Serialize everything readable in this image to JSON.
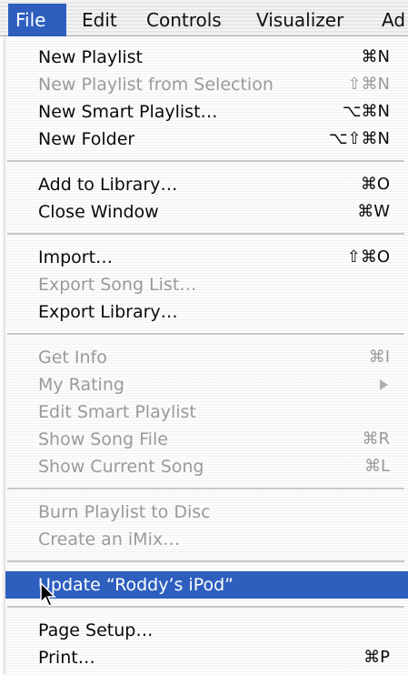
{
  "menubar": {
    "items": [
      "File",
      "Edit",
      "Controls",
      "Visualizer",
      "Ad"
    ],
    "active": "File"
  },
  "file_menu": {
    "new_playlist": {
      "label": "New Playlist",
      "shortcut": "⌘N"
    },
    "new_playlist_from_selection": {
      "label": "New Playlist from Selection",
      "shortcut": "⇧⌘N"
    },
    "new_smart_playlist": {
      "label": "New Smart Playlist…",
      "shortcut": "⌥⌘N"
    },
    "new_folder": {
      "label": "New Folder",
      "shortcut": "⌥⇧⌘N"
    },
    "add_to_library": {
      "label": "Add to Library…",
      "shortcut": "⌘O"
    },
    "close_window": {
      "label": "Close Window",
      "shortcut": "⌘W"
    },
    "import": {
      "label": "Import…",
      "shortcut": "⇧⌘O"
    },
    "export_song_list": {
      "label": "Export Song List…",
      "shortcut": ""
    },
    "export_library": {
      "label": "Export Library…",
      "shortcut": ""
    },
    "get_info": {
      "label": "Get Info",
      "shortcut": "⌘I"
    },
    "my_rating": {
      "label": "My Rating",
      "shortcut": ""
    },
    "edit_smart_playlist": {
      "label": "Edit Smart Playlist",
      "shortcut": ""
    },
    "show_song_file": {
      "label": "Show Song File",
      "shortcut": "⌘R"
    },
    "show_current_song": {
      "label": "Show Current Song",
      "shortcut": "⌘L"
    },
    "burn_playlist": {
      "label": "Burn Playlist to Disc",
      "shortcut": ""
    },
    "create_imix": {
      "label": "Create an iMix…",
      "shortcut": ""
    },
    "update_ipod": {
      "label": "Update “Roddy’s iPod”",
      "shortcut": ""
    },
    "page_setup": {
      "label": "Page Setup…",
      "shortcut": ""
    },
    "print": {
      "label": "Print…",
      "shortcut": "⌘P"
    }
  },
  "colors": {
    "highlight": "#2e5fbf",
    "disabled_text": "#9a9a9a"
  }
}
